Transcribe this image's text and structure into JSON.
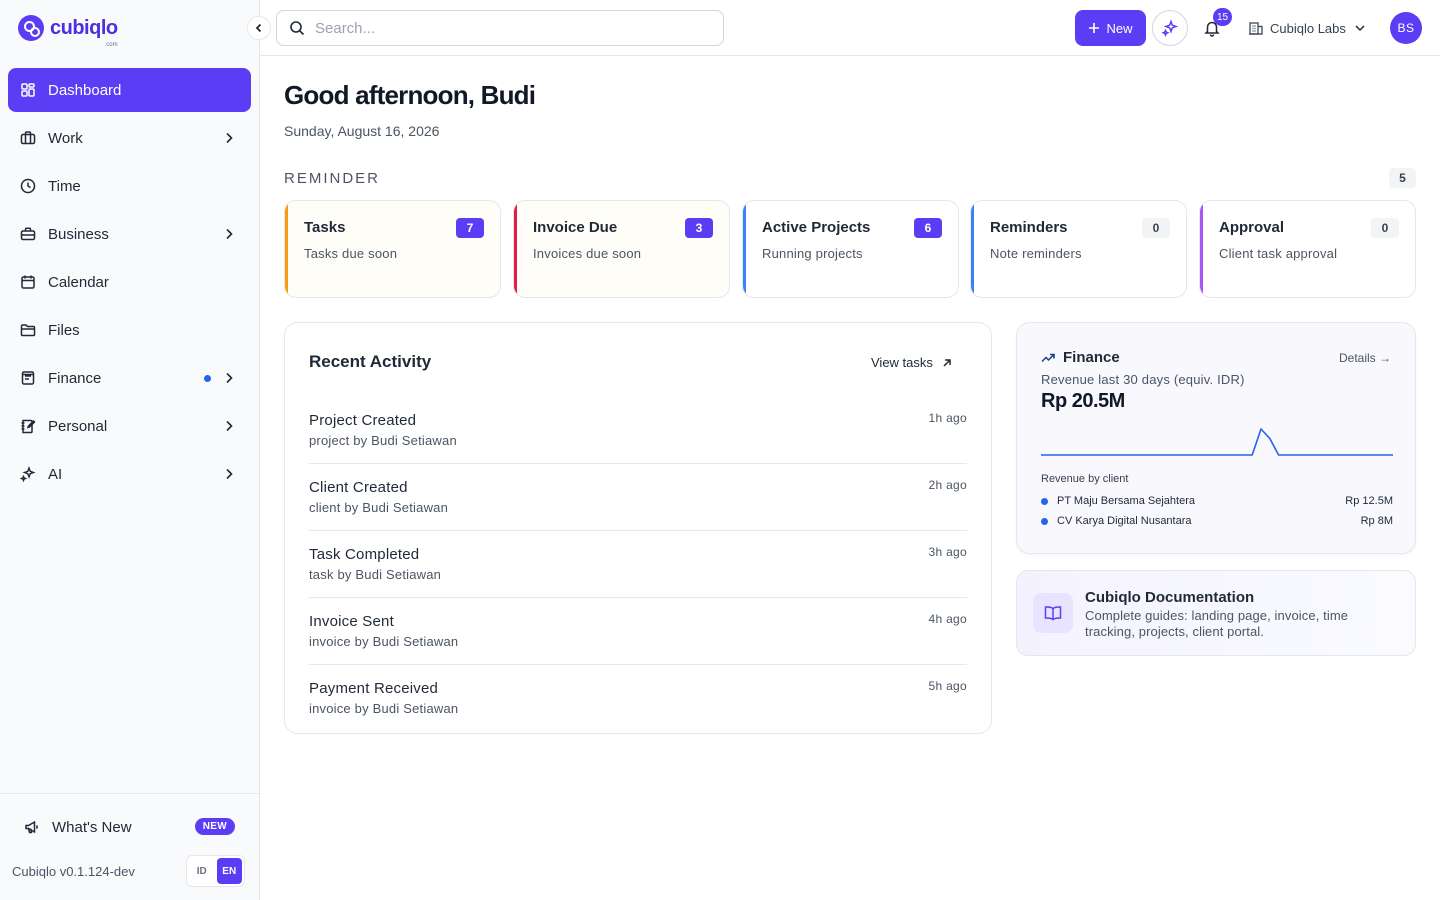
{
  "brand": {
    "name": "cubiqlo",
    "suffix": ".com"
  },
  "search": {
    "placeholder": "Search..."
  },
  "topbar": {
    "new_label": "New",
    "notifications_count": "15",
    "org_name": "Cubiqlo Labs",
    "avatar_initials": "BS"
  },
  "sidebar": {
    "items": [
      {
        "label": "Dashboard",
        "icon": "grid-icon",
        "active": true
      },
      {
        "label": "Work",
        "icon": "briefcase-icon"
      },
      {
        "label": "Time",
        "icon": "clock-icon"
      },
      {
        "label": "Business",
        "icon": "business-icon"
      },
      {
        "label": "Calendar",
        "icon": "calendar-icon"
      },
      {
        "label": "Files",
        "icon": "folder-icon"
      },
      {
        "label": "Finance",
        "icon": "receipt-icon"
      },
      {
        "label": "Personal",
        "icon": "notebook-icon"
      },
      {
        "label": "AI",
        "icon": "sparkle-icon"
      }
    ],
    "whats_new": "What's New",
    "new_badge": "NEW",
    "version": "Cubiqlo v0.1.124-dev",
    "lang_id": "ID",
    "lang_en": "EN"
  },
  "colors": {
    "accent": "#5b3df5",
    "blue": "#2563eb"
  },
  "main": {
    "greeting": "Good afternoon, Budi",
    "date": "Sunday, August 16, 2026",
    "reminder_title": "REMINDER",
    "reminder_count": "5",
    "cards": [
      {
        "title": "Tasks",
        "subtitle": "Tasks due soon",
        "count": "7",
        "accent": "#f59e0b"
      },
      {
        "title": "Invoice Due",
        "subtitle": "Invoices due soon",
        "count": "3",
        "accent": "#e11d48"
      },
      {
        "title": "Active Projects",
        "subtitle": "Running projects",
        "count": "6",
        "accent": "#3b82f6"
      },
      {
        "title": "Reminders",
        "subtitle": "Note reminders",
        "count": "0",
        "accent": "#3b82f6"
      },
      {
        "title": "Approval",
        "subtitle": "Client task approval",
        "count": "0",
        "accent": "#a855f7"
      }
    ]
  },
  "activity": {
    "title": "Recent Activity",
    "view_tasks": "View tasks",
    "items": [
      {
        "name": "Project Created",
        "by": "project by Budi Setiawan",
        "time": "1h ago"
      },
      {
        "name": "Client Created",
        "by": "client by Budi Setiawan",
        "time": "2h ago"
      },
      {
        "name": "Task Completed",
        "by": "task by Budi Setiawan",
        "time": "3h ago"
      },
      {
        "name": "Invoice Sent",
        "by": "invoice by Budi Setiawan",
        "time": "4h ago"
      },
      {
        "name": "Payment Received",
        "by": "invoice by Budi Setiawan",
        "time": "5h ago"
      }
    ]
  },
  "finance": {
    "title": "Finance",
    "details": "Details →",
    "subtitle": "Revenue last 30 days (equiv. IDR)",
    "total": "Rp 20.5M",
    "by_client_label": "Revenue by client",
    "clients": [
      {
        "name": "PT Maju Bersama Sejahtera",
        "amount": "Rp 12.5M"
      },
      {
        "name": "CV Karya Digital Nusantara",
        "amount": "Rp 8M"
      }
    ]
  },
  "chart_data": {
    "type": "line",
    "series": [
      {
        "values": [
          0,
          0,
          0,
          0,
          0,
          0,
          0,
          0,
          0,
          0,
          0,
          0,
          0,
          0,
          0,
          0,
          0,
          0,
          0,
          0,
          0,
          0,
          0,
          0,
          0,
          12.5,
          8,
          0,
          0,
          0,
          0,
          0,
          0,
          0,
          0,
          0,
          0,
          0,
          0,
          0,
          0
        ]
      }
    ],
    "grid": false,
    "legend": "none"
  },
  "docs": {
    "title": "Cubiqlo Documentation",
    "description": "Complete guides: landing page, invoice, time tracking, projects, client portal."
  }
}
